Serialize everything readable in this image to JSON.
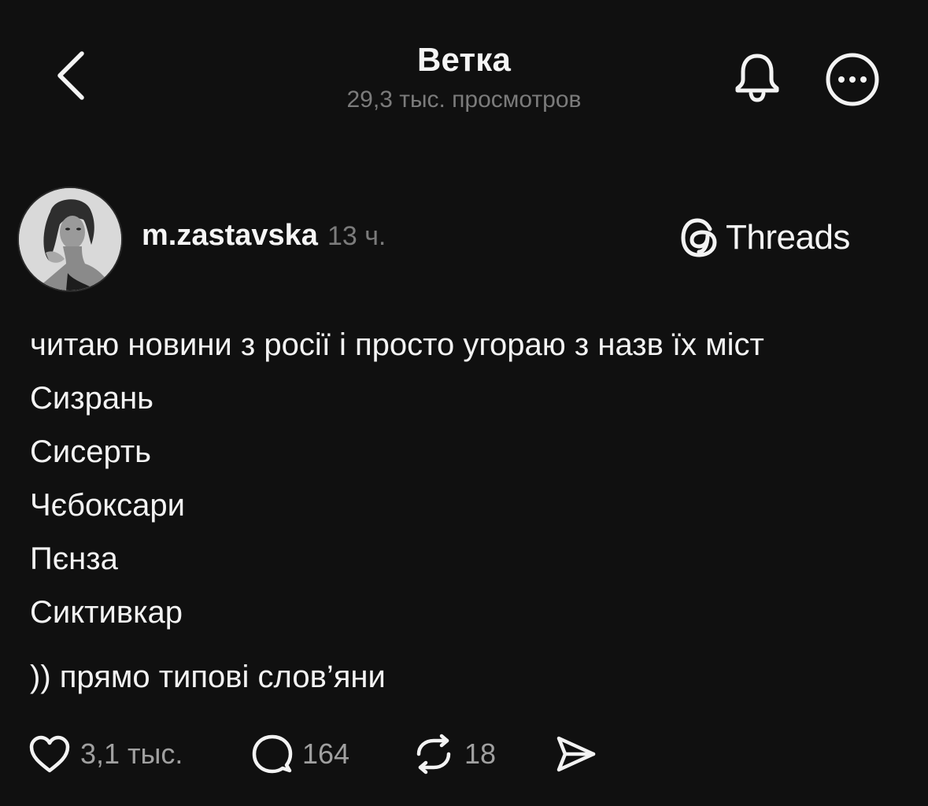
{
  "header": {
    "title": "Ветка",
    "views": "29,3 тыс. просмотров"
  },
  "icons": {
    "back": "chevron-left-icon",
    "notifications": "bell-icon",
    "more": "more-horizontal-icon",
    "brand": "threads-logo",
    "like": "heart-icon",
    "comment": "comment-icon",
    "repost": "repost-icon",
    "share": "send-icon"
  },
  "post": {
    "username": "m.zastavska",
    "time": "13 ч.",
    "brand": "Threads",
    "lines": [
      "читаю новини з росії і просто угораю з назв їх міст",
      "Сизрань",
      "Сисерть",
      "Чєбоксари",
      "Пєнза",
      "Сиктивкар"
    ],
    "closing": ")) прямо типові слов’яни"
  },
  "actions": {
    "likes": "3,1 тыс.",
    "comments": "164",
    "reposts": "18"
  },
  "colors": {
    "background": "#101010",
    "text": "#f3f3f3",
    "muted": "#7b7b7b"
  }
}
